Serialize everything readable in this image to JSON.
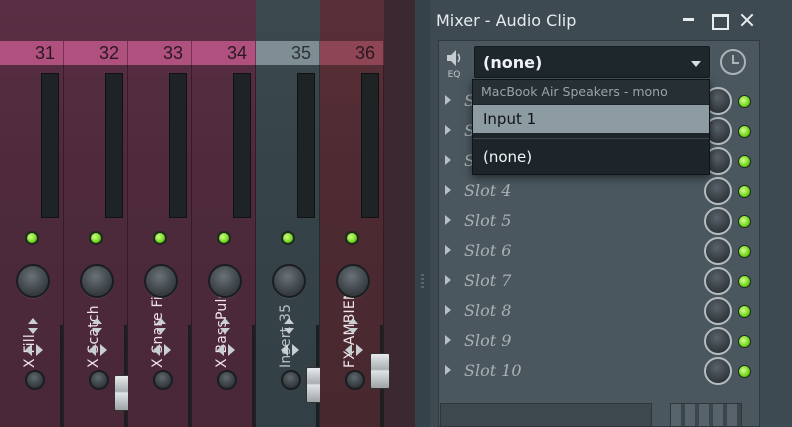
{
  "mixer": {
    "strips": [
      {
        "number": "31",
        "name": "X Fill",
        "color": "purple",
        "fader": null
      },
      {
        "number": "32",
        "name": "X Scatch",
        "color": "purple",
        "fader": 0.55
      },
      {
        "number": "33",
        "name": "X Snare Fill",
        "color": "purple",
        "fader": null
      },
      {
        "number": "34",
        "name": "X BassPulse",
        "color": "purple",
        "fader": null
      },
      {
        "number": "35",
        "name": "Insert 35",
        "color": "grey",
        "fader": 0.62
      },
      {
        "number": "36",
        "name": "FX AMBIENCE",
        "color": "red",
        "fader": 0.75
      }
    ]
  },
  "window": {
    "title": "Mixer - Audio Clip"
  },
  "eq_label": "EQ",
  "input_select": {
    "value": "(none)"
  },
  "dropdown": {
    "header": "MacBook Air Speakers - mono",
    "options": [
      "Input 1",
      "(none)"
    ]
  },
  "slots": [
    "Slot 1",
    "Slot 2",
    "Slot 3",
    "Slot 4",
    "Slot 5",
    "Slot 6",
    "Slot 7",
    "Slot 8",
    "Slot 9",
    "Slot 10"
  ],
  "colors": {
    "purple_strip": "#b0507e",
    "grey_strip": "#7f8e94",
    "red_strip": "#8e4656",
    "led_green": "#6fd61c",
    "highlight": "#8d9ba2"
  }
}
